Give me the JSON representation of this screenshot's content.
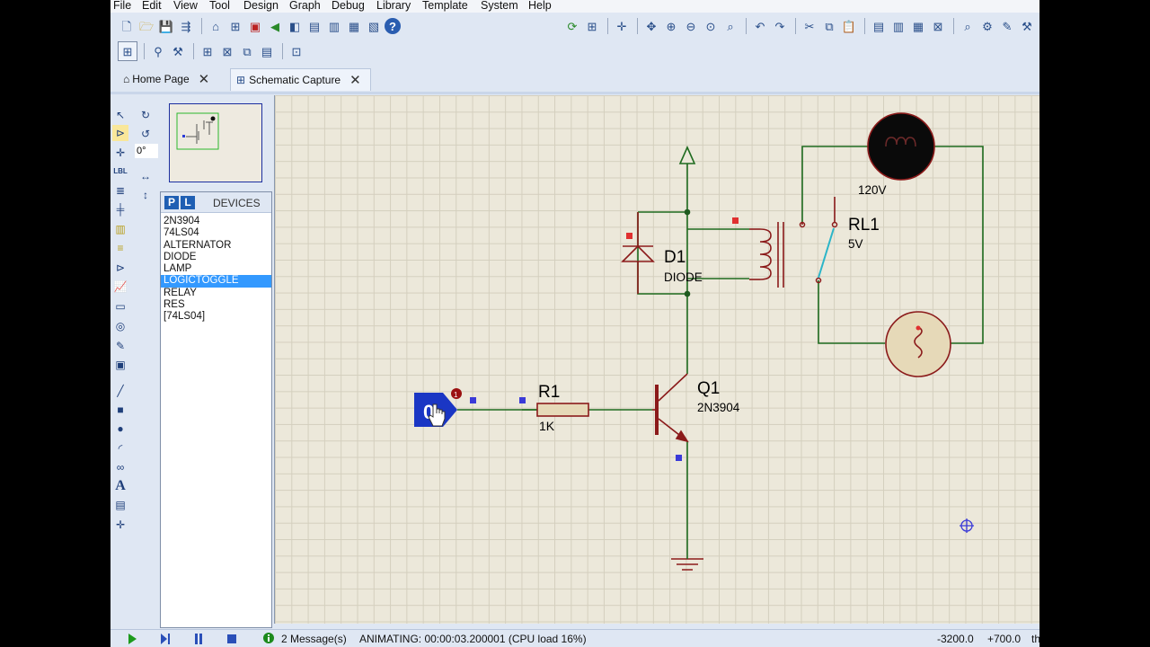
{
  "menu": [
    "File",
    "Edit",
    "View",
    "Tool",
    "Design",
    "Graph",
    "Debug",
    "Library",
    "Template",
    "System",
    "Help"
  ],
  "tabs": {
    "home": "Home Page",
    "schematic": "Schematic Capture"
  },
  "rotation": "0°",
  "devices": {
    "p": "P",
    "l": "L",
    "title": "DEVICES",
    "items": [
      "2N3904",
      "74LS04",
      "ALTERNATOR",
      "DIODE",
      "LAMP",
      "LOGICTOGGLE",
      "RELAY",
      "RES",
      "[74LS04]"
    ],
    "selected": "LOGICTOGGLE"
  },
  "schematic": {
    "toggle_state": "0",
    "r1_ref": "R1",
    "r1_value": "1K",
    "q1_ref": "Q1",
    "q1_value": "2N3904",
    "d1_ref": "D1",
    "d1_value": "DIODE",
    "rl1_ref": "RL1",
    "rl1_value": "5V",
    "lamp_value": "120V"
  },
  "status": {
    "messages": "2 Message(s)",
    "animating": "ANIMATING: 00:00:03.200001 (CPU load 16%)",
    "x": "-3200.0",
    "y": "+700.0",
    "units": "th"
  },
  "colors": {
    "wire": "#1f6b1f",
    "component": "#8b1a1a",
    "pin_blue": "#3a3ad8",
    "pin_red": "#e03030",
    "relay_contact": "#2bb5c8",
    "toggle_fill": "#1a36c4"
  }
}
